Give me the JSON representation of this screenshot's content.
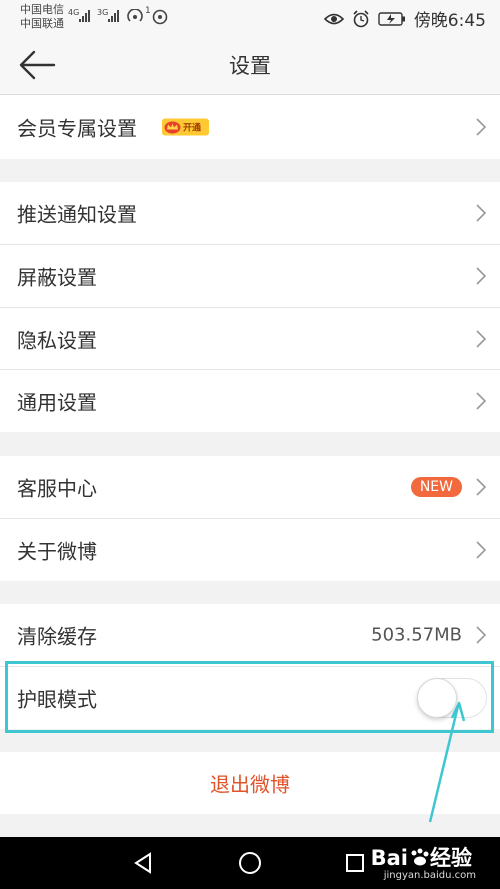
{
  "status_bar": {
    "carrier_1": "中国电信",
    "carrier_2": "中国联通",
    "net_1": "4G",
    "net_2": "3G",
    "hotspot_count": "1",
    "time": "傍晚6:45"
  },
  "header": {
    "title": "设置"
  },
  "sections": {
    "vip": {
      "label": "会员专属设置",
      "badge": "开通"
    },
    "push": {
      "label": "推送通知设置"
    },
    "block": {
      "label": "屏蔽设置"
    },
    "privacy": {
      "label": "隐私设置"
    },
    "general": {
      "label": "通用设置"
    },
    "service": {
      "label": "客服中心",
      "badge": "NEW"
    },
    "about": {
      "label": "关于微博"
    },
    "cache": {
      "label": "清除缓存",
      "value": "503.57MB"
    },
    "eye_mode": {
      "label": "护眼模式",
      "enabled": false
    },
    "logout": {
      "label": "退出微博"
    }
  },
  "watermark": {
    "brand": "Bai",
    "brand_2": "经验",
    "url": "jingyan.baidu.com"
  },
  "colors": {
    "accent_orange": "#f1693c",
    "logout_red": "#e0532b",
    "highlight_cyan": "#3ec7d1",
    "vip_gold": "#ffc933"
  }
}
